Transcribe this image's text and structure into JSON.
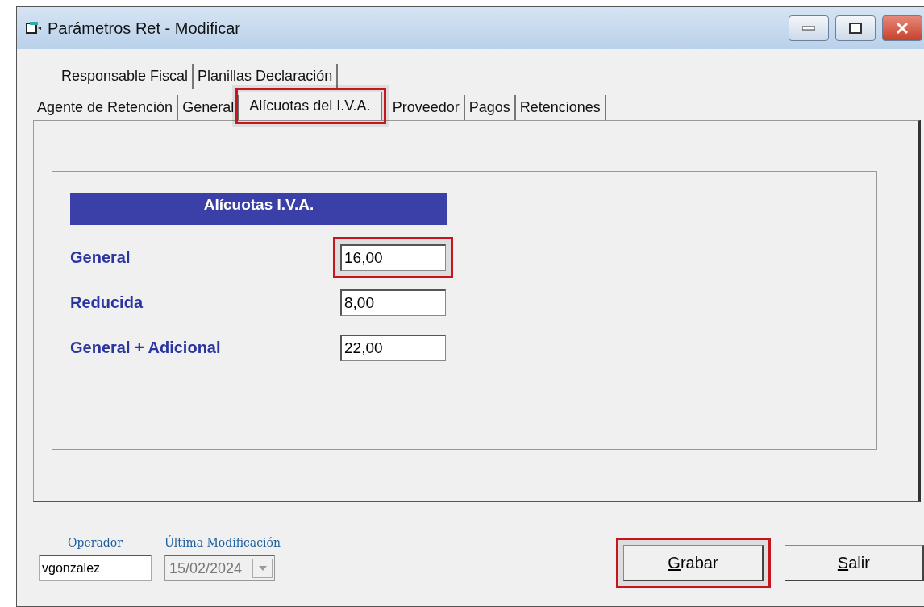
{
  "window": {
    "title": "Parámetros Ret - Modificar"
  },
  "tab_rows": [
    [
      {
        "label": "Responsable Fiscal",
        "selected": false,
        "highlighted": false
      },
      {
        "label": "Planillas Declaración",
        "selected": false,
        "highlighted": false
      }
    ],
    [
      {
        "label": "Agente de Retención",
        "selected": false,
        "highlighted": false
      },
      {
        "label": "General",
        "selected": false,
        "highlighted": false
      },
      {
        "label": "Alícuotas del I.V.A.",
        "selected": true,
        "highlighted": true
      },
      {
        "label": "Proveedor",
        "selected": false,
        "highlighted": false
      },
      {
        "label": "Pagos",
        "selected": false,
        "highlighted": false
      },
      {
        "label": "Retenciones",
        "selected": false,
        "highlighted": false
      }
    ]
  ],
  "group": {
    "title": "Alícuotas I.V.A.",
    "fields": [
      {
        "label": "General",
        "value": "16,00",
        "highlighted": true
      },
      {
        "label": "Reducida",
        "value": "8,00",
        "highlighted": false
      },
      {
        "label": "General + Adicional",
        "value": "22,00",
        "highlighted": false
      }
    ]
  },
  "footer": {
    "operator_label": "Operador",
    "operator_value": "vgonzalez",
    "date_label": "Última Modificación",
    "date_value": "15/02/2024",
    "buttons": [
      {
        "label": "Grabar",
        "highlighted": true
      },
      {
        "label": "Salir",
        "highlighted": false
      }
    ]
  }
}
